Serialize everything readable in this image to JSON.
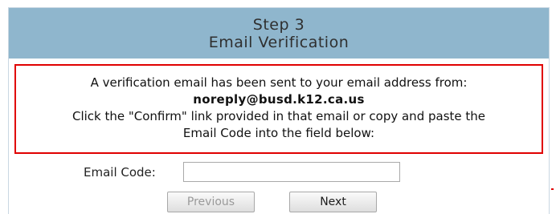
{
  "header": {
    "step": "Step 3",
    "title": "Email Verification"
  },
  "notice": {
    "line1": "A verification email has been sent to your email address from:",
    "sender": "noreply@busd.k12.ca.us",
    "line3": "Click the \"Confirm\" link provided in that email or copy and paste the",
    "line4": "Email Code into the field below:"
  },
  "form": {
    "email_code_label": "Email Code:",
    "email_code_value": ""
  },
  "buttons": {
    "previous": "Previous",
    "next": "Next"
  },
  "colors": {
    "header_bg": "#8fb6cd",
    "notice_border": "#e00000"
  }
}
